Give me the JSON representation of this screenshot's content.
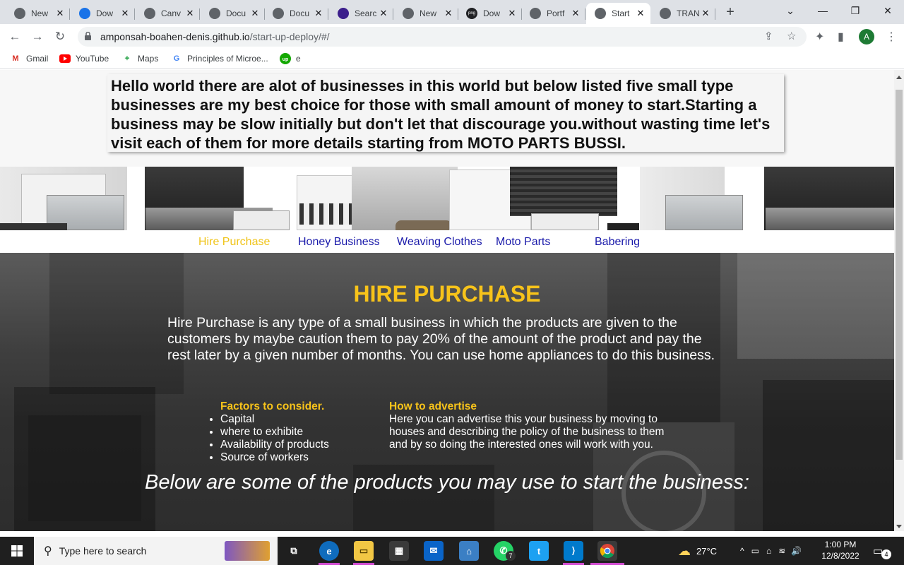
{
  "browser": {
    "tabs": [
      {
        "title": "New",
        "color": "#5f6368",
        "glyph": "◉"
      },
      {
        "title": "Dow",
        "color": "#1a73e8",
        "glyph": "⬇"
      },
      {
        "title": "Canv",
        "color": "#5f6368",
        "glyph": "◉"
      },
      {
        "title": "Docu",
        "color": "#5f6368",
        "glyph": "◉"
      },
      {
        "title": "Docu",
        "color": "#5f6368",
        "glyph": "◉"
      },
      {
        "title": "Searc",
        "color": "#3c1f8c",
        "glyph": "◉"
      },
      {
        "title": "New",
        "color": "#5f6368",
        "glyph": "◉"
      },
      {
        "title": "Dow",
        "color": "#202124",
        "glyph": "png"
      },
      {
        "title": "Portf",
        "color": "#5f6368",
        "glyph": "◉"
      },
      {
        "title": "Start",
        "color": "#5f6368",
        "glyph": "◉",
        "active": true
      },
      {
        "title": "TRAN",
        "color": "#5f6368",
        "glyph": "◉"
      }
    ],
    "url_host": "amponsah-boahen-denis.github.io",
    "url_path": "/start-up-deploy/#/",
    "avatar_letter": "A",
    "bookmarks": [
      {
        "label": "Gmail",
        "icon": "gmail-icon"
      },
      {
        "label": "YouTube",
        "icon": "youtube-icon"
      },
      {
        "label": "Maps",
        "icon": "maps-icon"
      },
      {
        "label": "Principles of Microe...",
        "icon": "google-icon"
      },
      {
        "label": "e",
        "icon": "upwork-icon"
      }
    ]
  },
  "page": {
    "intro": "Hello world there are alot of businesses in this world but below listed five small type businesses are my best choice for those with small amount of money to start.Starting a business may be slow initially but don't let that discourage you.without wasting time let's visit each of them for more details starting from MOTO PARTS BUSSI.",
    "nav": [
      "Hire Purchase",
      "Honey Business",
      "Weaving Clothes",
      "Moto Parts",
      "Babering"
    ],
    "active_nav": "Hire Purchase",
    "accent_color": "#f7c31a",
    "link_color": "#1a1aaa",
    "section_title": "HIRE PURCHASE",
    "section_description": "Hire Purchase is any type of a small business in which the products are given to the customers by maybe caution them to pay 20% of the amount of the product and pay the rest later by a given number of months. You can use home appliances to do this business.",
    "factors_heading": "Factors to consider.",
    "factors": [
      "Capital",
      "where to exhibite",
      "Availability of products",
      "Source of workers"
    ],
    "advertise_heading": "How to advertise",
    "advertise_text": "Here you can advertise this your business by moving to houses and describing the policy of the business to them and by so doing the interested ones will work with you.",
    "products_heading": "Below are some of the products you may use to start the business:"
  },
  "taskbar": {
    "search_placeholder": "Type here to search",
    "weather": "27°C",
    "time": "1:00 PM",
    "date": "12/8/2022",
    "notification_count": "4",
    "whatsapp_badge": "7"
  }
}
